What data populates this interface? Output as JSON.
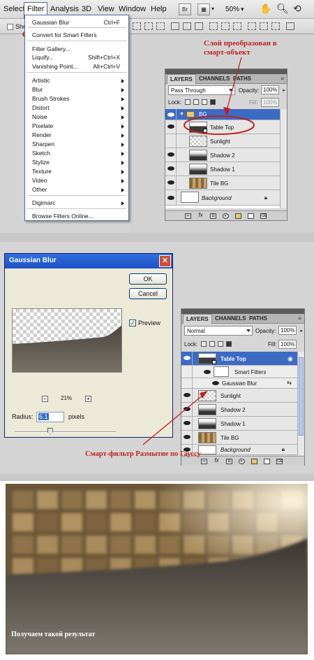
{
  "menubar": {
    "items": [
      "Select",
      "Filter",
      "Analysis",
      "3D",
      "View",
      "Window",
      "Help"
    ],
    "br_button": "Br",
    "zoom": "50%"
  },
  "options_bar": {
    "checkbox_label": "Sho"
  },
  "filter_menu": {
    "items": [
      {
        "label": "Gaussian Blur",
        "shortcut": "Ctrl+F"
      },
      {
        "label": "Convert for Smart Filters"
      },
      {
        "label": "Filter Gallery..."
      },
      {
        "label": "Liquify...",
        "shortcut": "Shift+Ctrl+X"
      },
      {
        "label": "Vanishing Point...",
        "shortcut": "Alt+Ctrl+V"
      },
      {
        "label": "Artistic"
      },
      {
        "label": "Blur"
      },
      {
        "label": "Brush Strokes"
      },
      {
        "label": "Distort"
      },
      {
        "label": "Noise"
      },
      {
        "label": "Pixelate"
      },
      {
        "label": "Render"
      },
      {
        "label": "Sharpen"
      },
      {
        "label": "Sketch"
      },
      {
        "label": "Stylize"
      },
      {
        "label": "Texture"
      },
      {
        "label": "Video"
      },
      {
        "label": "Other"
      },
      {
        "label": "Digimarc"
      },
      {
        "label": "Browse Filters Online..."
      }
    ]
  },
  "annotation1": "Слой преобразован в смарт-объект",
  "layers1": {
    "tabs": [
      "LAYERS",
      "CHANNELS",
      "PATHS"
    ],
    "blend_mode": "Pass Through",
    "opacity_label": "Opacity:",
    "opacity": "100%",
    "lock_label": "Lock:",
    "fill_label": "Fill:",
    "fill": "100%",
    "group_name": "BG",
    "layers": [
      "Table Top",
      "Sunlight",
      "Shadow 2",
      "Shadow 1",
      "Tile BG",
      "Background"
    ]
  },
  "gaussian": {
    "title": "Gaussian Blur",
    "close": "✕",
    "ok": "OK",
    "cancel": "Cancel",
    "preview_label": "Preview",
    "zoom": "21%",
    "minus": "−",
    "plus": "+",
    "radius_label": "Radius:",
    "radius_value": "6.1",
    "units": "pixels",
    "slider_fraction": 0.35
  },
  "annotation2": "Смарт-фильтр Размытие по Гауссу",
  "layers2": {
    "tabs": [
      "LAYERS",
      "CHANNELS",
      "PATHS"
    ],
    "blend_mode": "Normal",
    "opacity_label": "Opacity:",
    "opacity": "100%",
    "lock_label": "Lock:",
    "fill_label": "Fill:",
    "fill": "100%",
    "table_top": "Table Top",
    "smart_filters": "Smart Filters",
    "gaussian_blur": "Gaussian Blur",
    "layers": [
      "Sunlight",
      "Shadow 2",
      "Shadow 1",
      "Tile BG",
      "Background"
    ]
  },
  "result_caption": "Получаем такой результат",
  "colors": {
    "annotation": "#c0211f",
    "selection": "#3c6bc4",
    "xp_title": "#2f6fe0"
  }
}
